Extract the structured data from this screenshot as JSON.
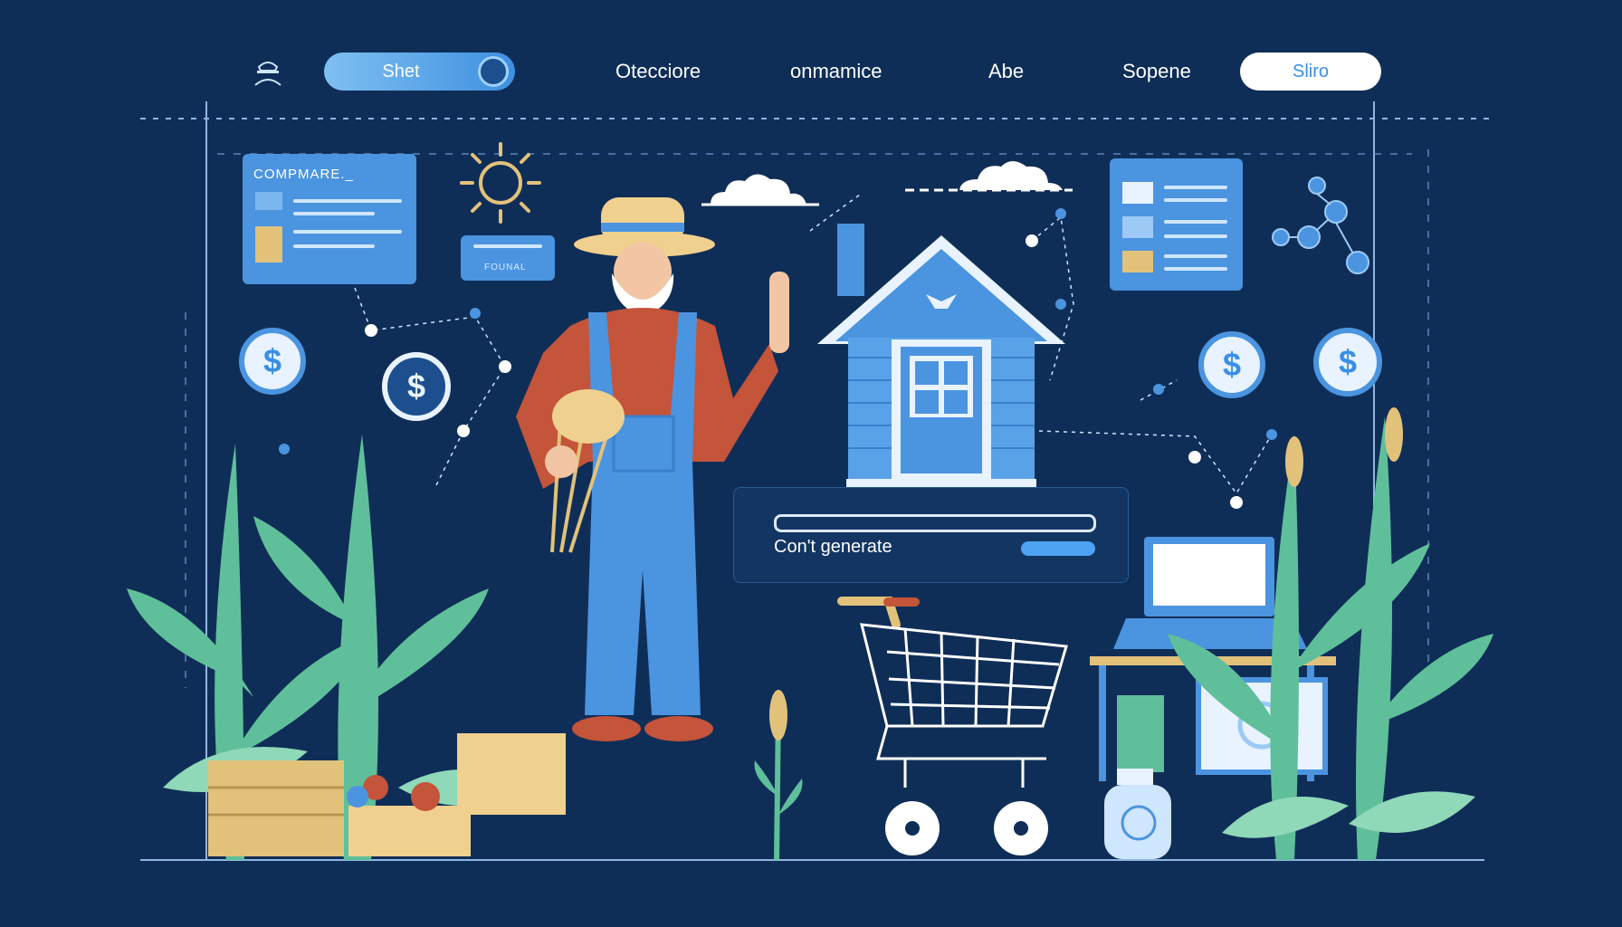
{
  "nav": {
    "toggle_label": "Shet",
    "links": [
      "Otecciore",
      "onmamice",
      "Abe",
      "Sopene"
    ],
    "pill_label": "Sliro"
  },
  "cards": {
    "left_title": "COMPMARE._",
    "small_badge": "FOUNAL"
  },
  "generate": {
    "label": "Con't generate"
  },
  "icons": {
    "user": "user-icon",
    "sun": "sun-icon",
    "cloud": "cloud-icon",
    "coin": "dollar-coin-icon",
    "gear": "gear-icon",
    "cart": "shopping-cart-icon",
    "laptop": "laptop-icon",
    "house": "house-icon",
    "farmer": "farmer-illustration"
  },
  "colors": {
    "background": "#0f2e57",
    "accent_blue": "#4b94e0",
    "light_blue": "#cfe6ff",
    "green": "#5fbf9a",
    "gold": "#e2c27a",
    "shirt_red": "#c4543a"
  }
}
